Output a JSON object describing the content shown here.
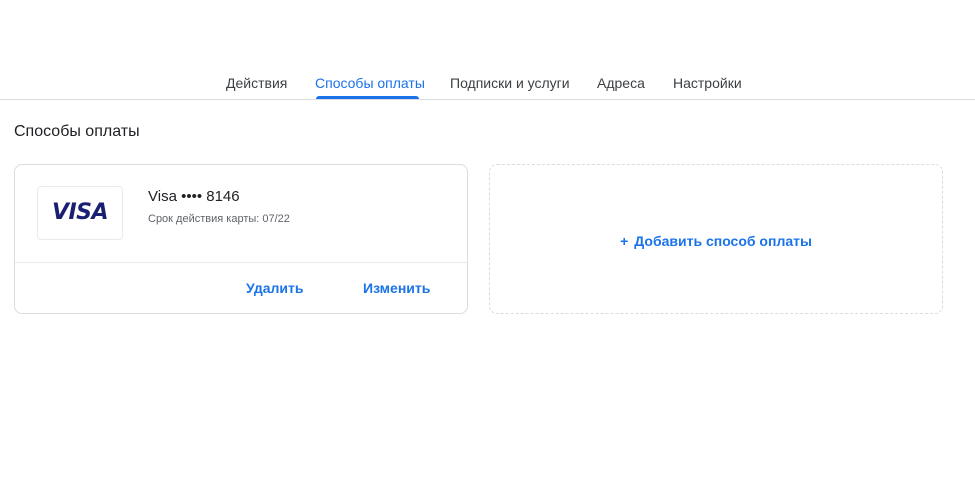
{
  "tabs": [
    {
      "label": "Действия",
      "active": false
    },
    {
      "label": "Способы оплаты",
      "active": true
    },
    {
      "label": "Подписки и услуги",
      "active": false
    },
    {
      "label": "Адреса",
      "active": false
    },
    {
      "label": "Настройки",
      "active": false
    }
  ],
  "section_title": "Способы оплаты",
  "payment_card": {
    "logo_text": "VISA",
    "name": "Visa •••• 8146",
    "expiry": "Срок действия карты: 07/22",
    "delete_label": "Удалить",
    "edit_label": "Изменить"
  },
  "add_payment": {
    "icon": "plus-icon",
    "plus_glyph": "+",
    "label": "Добавить способ оплаты"
  },
  "colors": {
    "accent": "#1a73e8",
    "visa_brand": "#1a1f71",
    "border": "#dadce0",
    "text": "#202124"
  }
}
